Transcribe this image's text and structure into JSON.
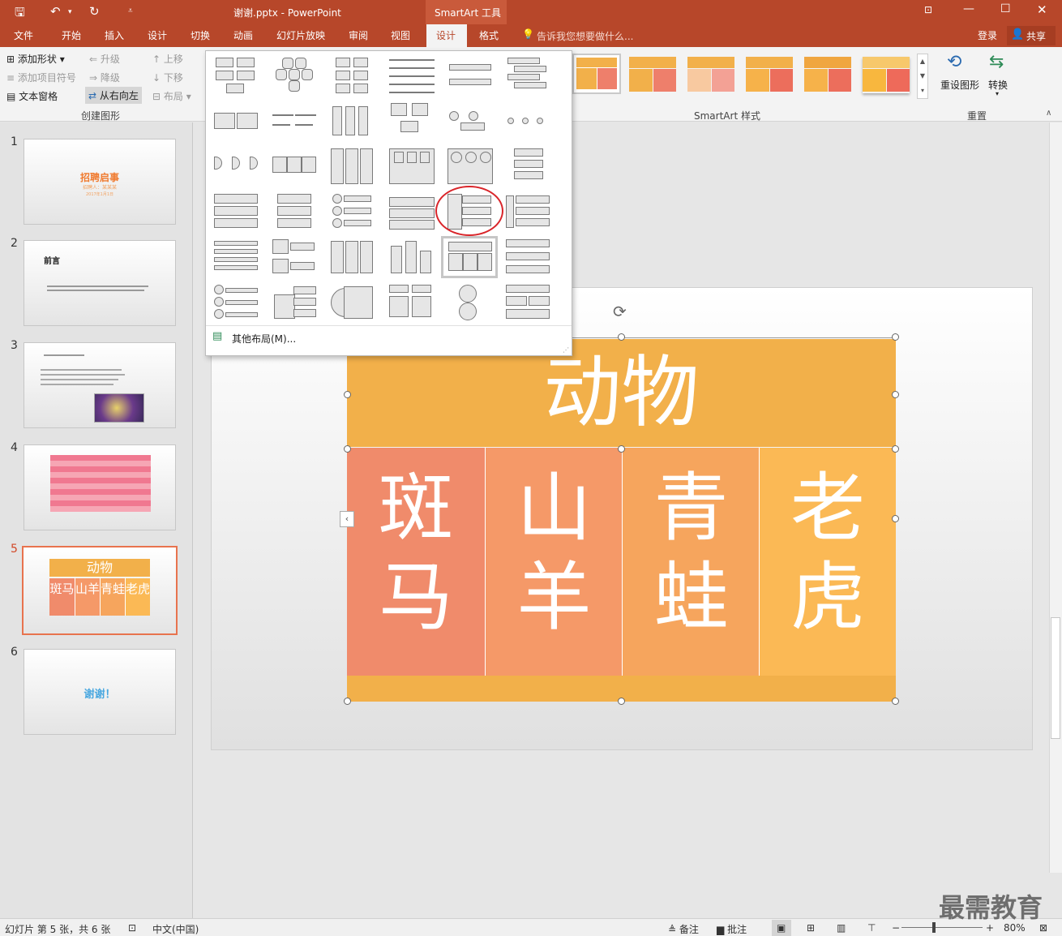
{
  "window": {
    "title": "谢谢.pptx - PowerPoint",
    "context_tool": "SmartArt 工具"
  },
  "tabs": [
    "文件",
    "开始",
    "插入",
    "设计",
    "切换",
    "动画",
    "幻灯片放映",
    "审阅",
    "视图",
    "设计",
    "格式"
  ],
  "tell_me": "告诉我您想要做什么...",
  "signin": "登录",
  "share": "共享",
  "ribbon": {
    "add_shape": "添加形状",
    "add_bullet": "添加项目符号",
    "text_pane": "文本窗格",
    "promote": "升级",
    "demote": "降级",
    "right_to_left": "从右向左",
    "move_up": "上移",
    "move_down": "下移",
    "layout": "布局",
    "group_create": "创建图形",
    "group_styles": "SmartArt 样式",
    "reset_graphic": "重设图形",
    "convert": "转换",
    "group_reset": "重置"
  },
  "gallery": {
    "more_layouts": "其他布局(M)..."
  },
  "thumbnails": [
    {
      "num": "1",
      "title": "招聘启事",
      "subtitle": "招聘人：某某某",
      "date": "2017年1月1日"
    },
    {
      "num": "2",
      "title": "前言"
    },
    {
      "num": "3"
    },
    {
      "num": "4"
    },
    {
      "num": "5",
      "title": "动物",
      "cells": [
        "斑马",
        "山羊",
        "青蛙",
        "老虎"
      ]
    },
    {
      "num": "6",
      "title": "谢谢！"
    }
  ],
  "slide": {
    "header": "动物",
    "cells": [
      "斑马",
      "山羊",
      "青蛙",
      "老虎"
    ]
  },
  "colors": {
    "header": "#f2b04a",
    "cell1": "#f08b6b",
    "cell2": "#f59968",
    "cell3": "#f6a55d",
    "cell4": "#fbb955",
    "accent": "#b7472a"
  },
  "status": {
    "slide_info": "幻灯片 第 5 张，共 6 张",
    "language": "中文(中国)",
    "notes": "备注",
    "comments": "批注",
    "zoom": "80%"
  },
  "watermark": "最需教育"
}
